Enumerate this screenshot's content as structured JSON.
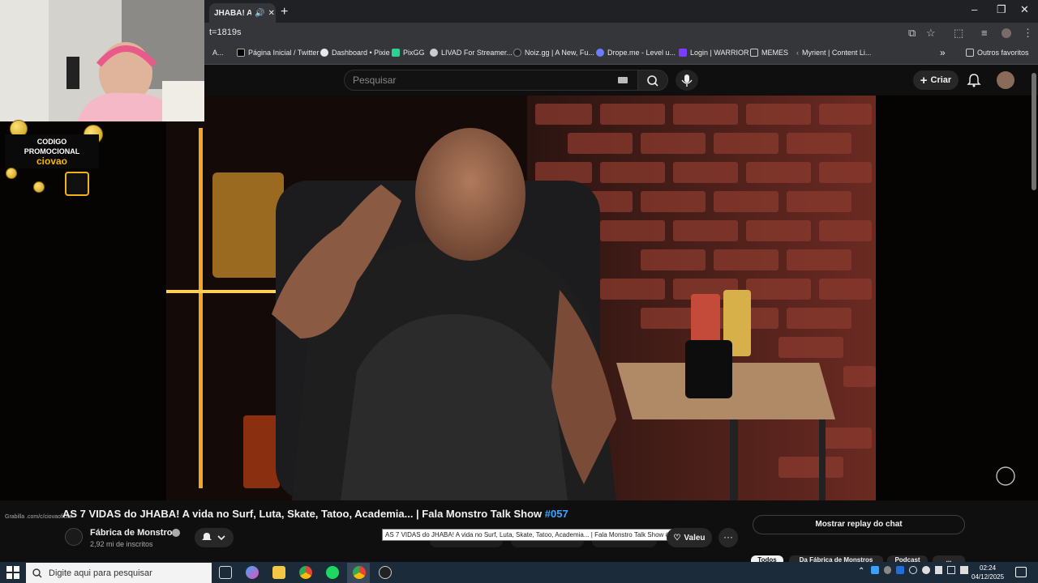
{
  "browser": {
    "tab_title": "JHABA! A vid",
    "url": "t=1819s",
    "bookmarks": [
      {
        "label": "A...",
        "icon": "folder-icon"
      },
      {
        "label": "Página Inicial / Twitter",
        "icon": "x-logo-icon"
      },
      {
        "label": "Dashboard • Pixie",
        "icon": "pixie-icon"
      },
      {
        "label": "PixGG",
        "icon": "pixgg-icon"
      },
      {
        "label": "LIVAD For Streamer...",
        "icon": "livad-icon"
      },
      {
        "label": "Noiz.gg | A New, Fu...",
        "icon": "noiz-icon"
      },
      {
        "label": "Drope.me - Level u...",
        "icon": "drope-icon"
      },
      {
        "label": "Login | WARRIOR",
        "icon": "warrior-icon"
      },
      {
        "label": "MEMES",
        "icon": "folder-icon"
      },
      {
        "label": "Myrient | Content Li...",
        "icon": "myrient-icon"
      }
    ],
    "more_bookmarks": "»",
    "favorites_label": "Outros favoritos"
  },
  "masthead": {
    "search_placeholder": "Pesquisar",
    "create_label": "Criar"
  },
  "overlay": {
    "promo_line1": "CODIGO",
    "promo_line2": "PROMOCIONAL",
    "promo_code": "ciovao",
    "grab_link": "Grabilla .com/c/ciovaoficial"
  },
  "video": {
    "title_prefix": "AS 7 VIDAS do JHABA! A vida no Surf, Luta, Skate, Tatoo, Academia... | Fala Monstro Talk Show ",
    "title_hash": "#057",
    "tooltip": "AS 7 VIDAS do JHABA! A vida no Surf, Luta, Skate, Tatoo, Academia... | Fala Monstro Talk Show #057",
    "channel_name": "Fábrica de Monstros",
    "subscribers": "2,92 mi de inscritos",
    "thanks_label": "Valeu",
    "more_label": "···",
    "replay_chat_label": "Mostrar replay do chat",
    "chips": [
      "Todos",
      "Da Fábrica de Monstros",
      "Podcast",
      "..."
    ]
  },
  "taskbar": {
    "search_placeholder": "Digite aqui para pesquisar",
    "time": "02:24",
    "date": "04/12/2025"
  }
}
